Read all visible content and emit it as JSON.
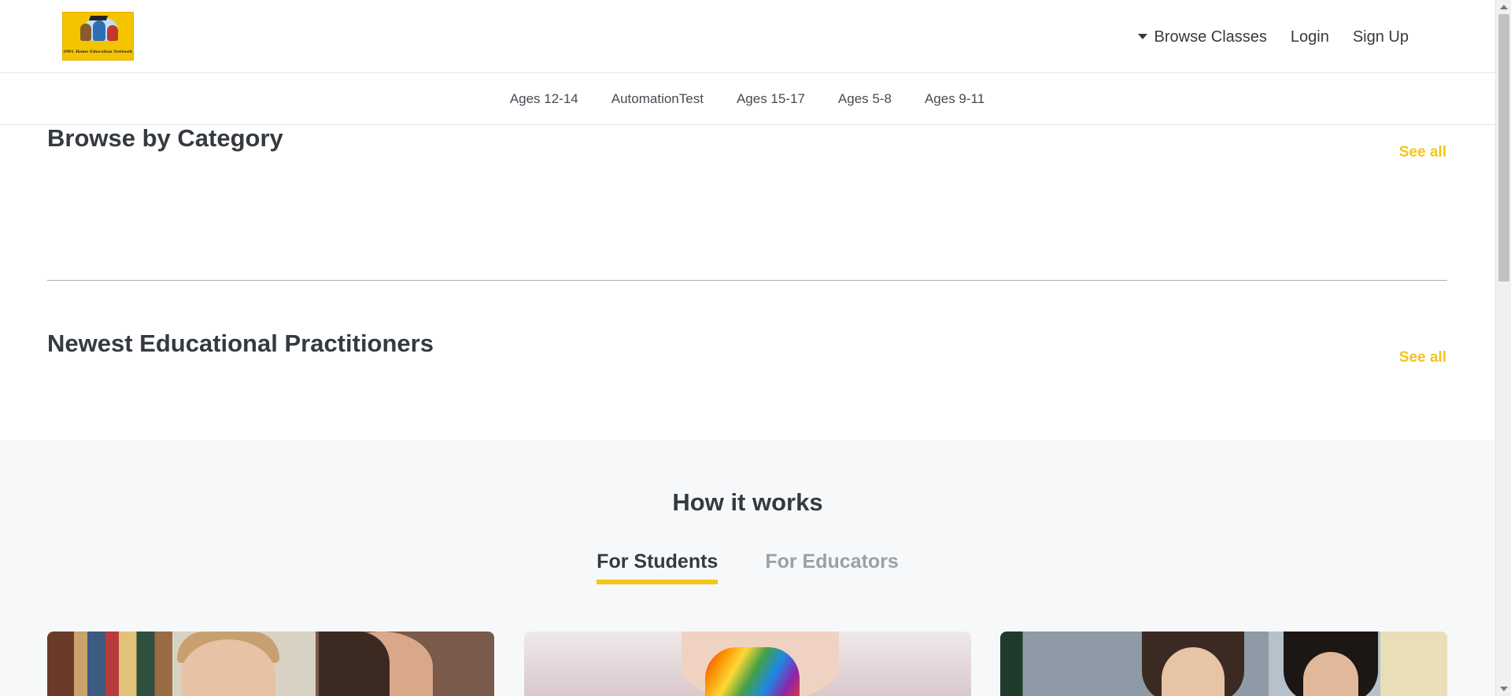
{
  "header": {
    "logo": {
      "text": "OWL Home Education Network",
      "alt": "OWL Home Education Network logo"
    },
    "nav": {
      "browse_classes": "Browse Classes",
      "login": "Login",
      "sign_up": "Sign Up"
    }
  },
  "categories": [
    "Ages 12-14",
    "AutomationTest",
    "Ages 15-17",
    "Ages 5-8",
    "Ages 9-11"
  ],
  "browse_by_category": {
    "title": "Browse by Category",
    "see_all": "See all"
  },
  "newest_practitioners": {
    "title": "Newest Educational Practitioners",
    "see_all": "See all"
  },
  "how_it_works": {
    "title": "How it works",
    "tabs": [
      {
        "label": "For Students",
        "active": true
      },
      {
        "label": "For Educators",
        "active": false
      }
    ]
  },
  "colors": {
    "accent": "#f5c518",
    "text": "#343a40",
    "muted": "#9aa0a6",
    "section_bg": "#f7f8f9"
  }
}
